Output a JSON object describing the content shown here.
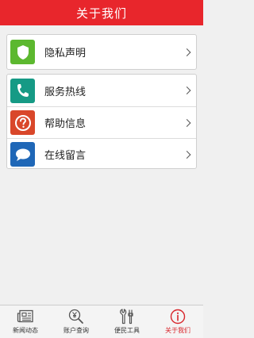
{
  "header": {
    "title": "关于我们"
  },
  "menu": {
    "group1": [
      {
        "label": "隐私声明",
        "icon": "shield-icon",
        "color": "#5cb82f"
      }
    ],
    "group2": [
      {
        "label": "服务热线",
        "icon": "phone-icon",
        "color": "#169a85"
      },
      {
        "label": "帮助信息",
        "icon": "question-icon",
        "color": "#d9472a"
      },
      {
        "label": "在线留言",
        "icon": "chat-icon",
        "color": "#1f67b7"
      }
    ]
  },
  "tabbar": {
    "items": [
      {
        "label": "新闻动态",
        "icon": "newspaper-icon",
        "active": false
      },
      {
        "label": "账户查询",
        "icon": "yen-search-icon",
        "active": false
      },
      {
        "label": "便民工具",
        "icon": "tools-icon",
        "active": false
      },
      {
        "label": "关于我们",
        "icon": "info-icon",
        "active": true
      }
    ],
    "active_color": "#d8262c"
  }
}
